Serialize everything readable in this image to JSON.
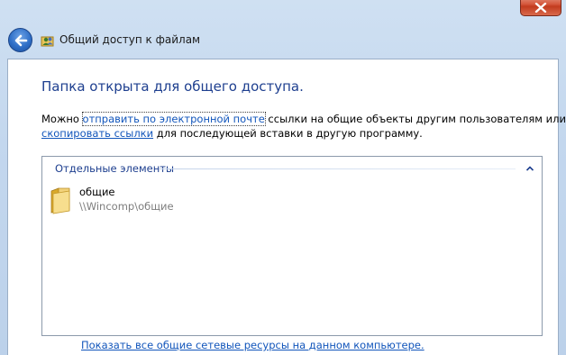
{
  "window": {
    "title": "Общий доступ к файлам",
    "icons": {
      "close": "close-icon",
      "back": "back-arrow-icon",
      "title": "sharing-wizard-icon"
    }
  },
  "main": {
    "heading": "Папка открыта для общего доступа.",
    "description": {
      "prefix": "Можно ",
      "email_link": "отправить по электронной почте",
      "middle": " ссылки на общие объекты другим пользователям или",
      "copy_link": "скопировать ссылки",
      "suffix": " для последующей вставки в другую программу."
    },
    "group": {
      "header": "Отдельные элементы",
      "collapse_icon": "chevron-up-icon",
      "items": [
        {
          "name": "общие",
          "path": "\\\\Wincomp\\общие",
          "icon": "folder-icon"
        }
      ]
    },
    "show_all_link": "Показать все общие сетевые ресурсы на данном компьютере."
  },
  "colors": {
    "heading": "#1e3f8f",
    "link": "#1155bb",
    "frame": "#c3d7ee",
    "close_button": "#c23b1e"
  }
}
